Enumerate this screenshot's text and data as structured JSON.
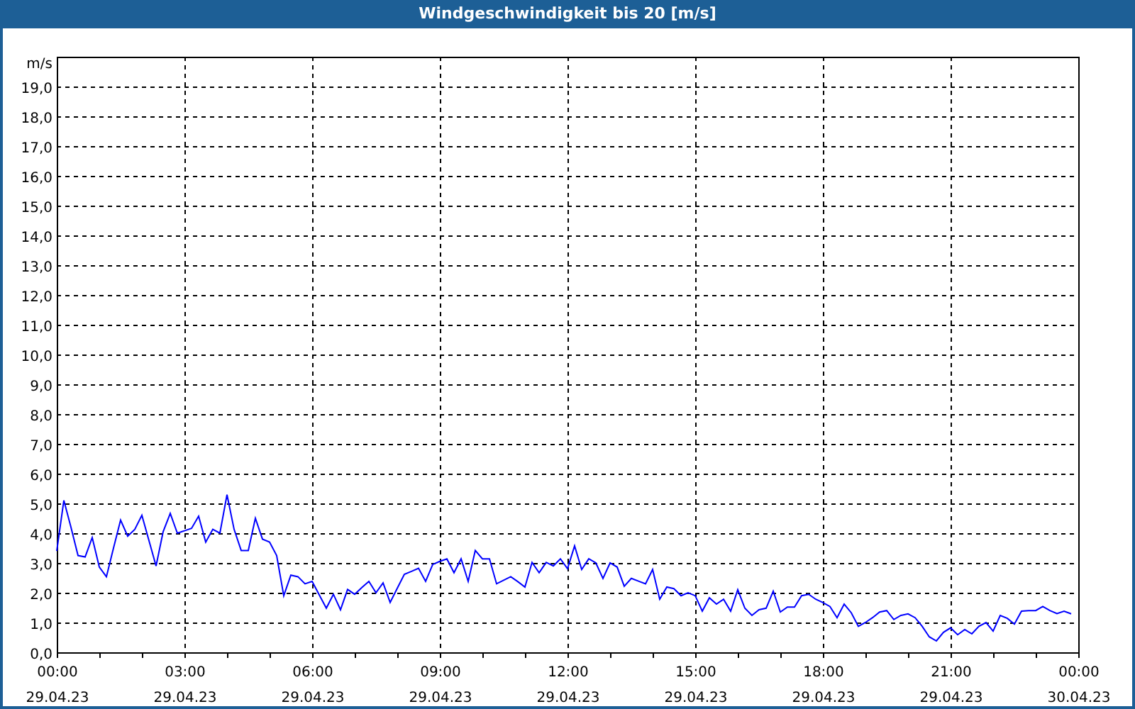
{
  "window": {
    "title": "Windgeschwindigkeit bis 20 [m/s]"
  },
  "chart": {
    "chart_data": {
      "type": "line",
      "ylabel": "m/s",
      "ylim": [
        0,
        20
      ],
      "grid": true,
      "yticks": [
        {
          "value": 0,
          "label": "0,0"
        },
        {
          "value": 1,
          "label": "1,0"
        },
        {
          "value": 2,
          "label": "2,0"
        },
        {
          "value": 3,
          "label": "3,0"
        },
        {
          "value": 4,
          "label": "4,0"
        },
        {
          "value": 5,
          "label": "5,0"
        },
        {
          "value": 6,
          "label": "6,0"
        },
        {
          "value": 7,
          "label": "7,0"
        },
        {
          "value": 8,
          "label": "8,0"
        },
        {
          "value": 9,
          "label": "9,0"
        },
        {
          "value": 10,
          "label": "10,0"
        },
        {
          "value": 11,
          "label": "11,0"
        },
        {
          "value": 12,
          "label": "12,0"
        },
        {
          "value": 13,
          "label": "13,0"
        },
        {
          "value": 14,
          "label": "14,0"
        },
        {
          "value": 15,
          "label": "15,0"
        },
        {
          "value": 16,
          "label": "16,0"
        },
        {
          "value": 17,
          "label": "17,0"
        },
        {
          "value": 18,
          "label": "18,0"
        },
        {
          "value": 19,
          "label": "19,0"
        }
      ],
      "categories": [
        "00:00 29.04.23",
        null,
        null,
        null,
        null,
        null,
        null,
        null,
        null,
        null,
        null,
        null,
        null,
        null,
        null,
        null,
        null,
        null,
        "03:00 29.04.23",
        null,
        null,
        null,
        null,
        null,
        null,
        null,
        null,
        null,
        null,
        null,
        null,
        null,
        null,
        null,
        null,
        null,
        "06:00 29.04.23",
        null,
        null,
        null,
        null,
        null,
        null,
        null,
        null,
        null,
        null,
        null,
        null,
        null,
        null,
        null,
        null,
        null,
        "09:00 29.04.23",
        null,
        null,
        null,
        null,
        null,
        null,
        null,
        null,
        null,
        null,
        null,
        null,
        null,
        null,
        null,
        null,
        null,
        "12:00 29.04.23",
        null,
        null,
        null,
        null,
        null,
        null,
        null,
        null,
        null,
        null,
        null,
        null,
        null,
        null,
        null,
        null,
        null,
        "15:00 29.04.23",
        null,
        null,
        null,
        null,
        null,
        null,
        null,
        null,
        null,
        null,
        null,
        null,
        null,
        null,
        null,
        null,
        null,
        "18:00 29.04.23",
        null,
        null,
        null,
        null,
        null,
        null,
        null,
        null,
        null,
        null,
        null,
        null,
        null,
        null,
        null,
        null,
        null,
        "21:00 29.04.23",
        null,
        null,
        null,
        null,
        null,
        null,
        null,
        null,
        null,
        null,
        null,
        null,
        null,
        null,
        null,
        null,
        null,
        "00:00 30.04.23"
      ],
      "series": [
        {
          "color": "#0000ff",
          "values": [
            3.4,
            5.1,
            4.2,
            3.25,
            3.2,
            3.85,
            2.86,
            2.54,
            3.5,
            4.44,
            3.9,
            4.13,
            4.6,
            3.75,
            2.9,
            4.05,
            4.66,
            4.0,
            4.08,
            4.16,
            4.57,
            3.7,
            4.13,
            4.0,
            5.29,
            4.13,
            3.42,
            3.42,
            4.5,
            3.8,
            3.7,
            3.25,
            1.9,
            2.59,
            2.54,
            2.3,
            2.38,
            1.93,
            1.48,
            1.95,
            1.43,
            2.11,
            1.95,
            2.17,
            2.38,
            2.0,
            2.33,
            1.67,
            2.15,
            2.62,
            2.72,
            2.82,
            2.38,
            2.95,
            3.05,
            3.14,
            2.67,
            3.14,
            2.38,
            3.42,
            3.14,
            3.14,
            2.3,
            2.42,
            2.54,
            2.37,
            2.19,
            3.02,
            2.67,
            3.02,
            2.9,
            3.14,
            2.81,
            3.57,
            2.78,
            3.14,
            3.0,
            2.48,
            3.0,
            2.86,
            2.22,
            2.48,
            2.39,
            2.3,
            2.78,
            1.78,
            2.19,
            2.14,
            1.9,
            2.0,
            1.9,
            1.38,
            1.83,
            1.62,
            1.78,
            1.38,
            2.1,
            1.48,
            1.24,
            1.43,
            1.48,
            2.05,
            1.35,
            1.52,
            1.52,
            1.9,
            1.95,
            1.78,
            1.67,
            1.54,
            1.16,
            1.62,
            1.33,
            0.87,
            1.0,
            1.16,
            1.35,
            1.4,
            1.1,
            1.24,
            1.29,
            1.16,
            0.87,
            0.52,
            0.38,
            0.67,
            0.82,
            0.59,
            0.76,
            0.62,
            0.87,
            1.0,
            0.71,
            1.24,
            1.14,
            0.95,
            1.38,
            1.4,
            1.4,
            1.54,
            1.4,
            1.3,
            1.38,
            1.29,
            null
          ]
        }
      ]
    }
  }
}
